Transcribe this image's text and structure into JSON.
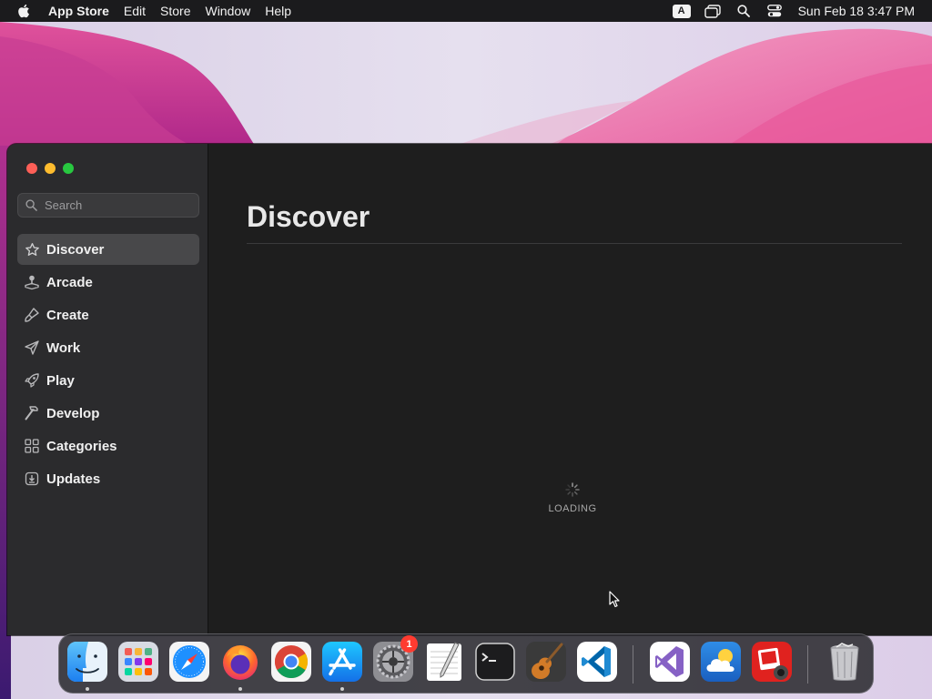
{
  "menubar": {
    "app_name": "App Store",
    "menus": [
      "Edit",
      "Store",
      "Window",
      "Help"
    ],
    "input_source": "A",
    "clock": "Sun Feb 18  3:47 PM"
  },
  "sidebar": {
    "search_placeholder": "Search",
    "items": [
      {
        "label": "Discover",
        "icon": "star-icon",
        "active": true
      },
      {
        "label": "Arcade",
        "icon": "joystick-icon",
        "active": false
      },
      {
        "label": "Create",
        "icon": "brush-icon",
        "active": false
      },
      {
        "label": "Work",
        "icon": "paper-plane-icon",
        "active": false
      },
      {
        "label": "Play",
        "icon": "rocket-icon",
        "active": false
      },
      {
        "label": "Develop",
        "icon": "hammer-icon",
        "active": false
      },
      {
        "label": "Categories",
        "icon": "grid-icon",
        "active": false
      },
      {
        "label": "Updates",
        "icon": "download-icon",
        "active": false
      }
    ]
  },
  "main": {
    "title": "Discover",
    "loading_label": "LOADING"
  },
  "dock": {
    "apps": [
      {
        "name": "Finder",
        "icon": "finder-icon",
        "running": true
      },
      {
        "name": "Launchpad",
        "icon": "launchpad-icon",
        "running": false
      },
      {
        "name": "Safari",
        "icon": "safari-icon",
        "running": false
      },
      {
        "name": "Firefox",
        "icon": "firefox-icon",
        "running": true
      },
      {
        "name": "Chrome",
        "icon": "chrome-icon",
        "running": false
      },
      {
        "name": "App Store",
        "icon": "app-store-icon",
        "running": true
      },
      {
        "name": "System Preferences",
        "icon": "system-preferences-icon",
        "running": false,
        "badge": "1"
      },
      {
        "name": "TextEdit",
        "icon": "textedit-icon",
        "running": false
      },
      {
        "name": "Terminal",
        "icon": "terminal-icon",
        "running": false
      },
      {
        "name": "GarageBand",
        "icon": "garageband-icon",
        "running": false
      },
      {
        "name": "Visual Studio Code",
        "icon": "vscode-icon",
        "running": false
      },
      {
        "name": "Visual Studio",
        "icon": "visual-studio-icon",
        "running": false
      },
      {
        "name": "Weather",
        "icon": "weather-icon",
        "running": false
      },
      {
        "name": "Photo Booth",
        "icon": "photo-booth-icon",
        "running": false
      },
      {
        "name": "Trash",
        "icon": "trash-icon",
        "running": false
      }
    ]
  },
  "colors": {
    "menubar_bg": "#1b1b1d",
    "window_bg": "#1e1e1e",
    "sidebar_bg": "#2b2b2d",
    "active_item_bg": "#48484a",
    "close": "#fe5f57",
    "minimize": "#febc2e",
    "maximize": "#28c840",
    "badge": "#ff3b30"
  }
}
